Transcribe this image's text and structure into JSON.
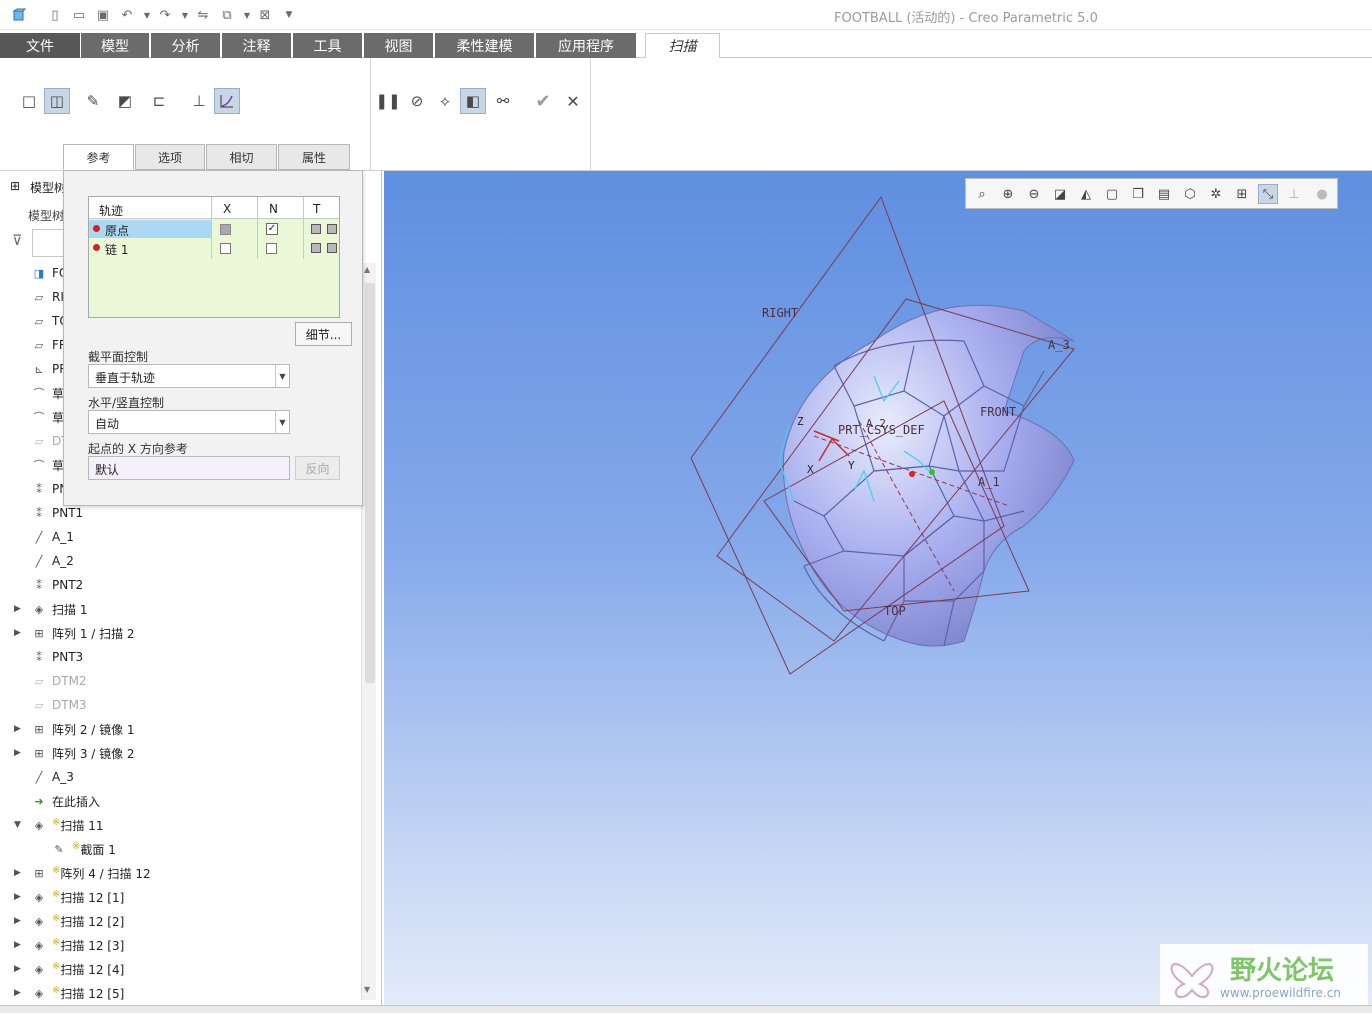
{
  "window": {
    "title": "FOOTBALL (活动的) - Creo Parametric 5.0"
  },
  "quick_access": {
    "icons": [
      "app-icon",
      "new-icon",
      "open-icon",
      "save-icon",
      "undo-icon",
      "undo-dropdown-icon",
      "redo-icon",
      "redo-dropdown-icon",
      "regenerate-icon",
      "windows-icon",
      "windows-dropdown-icon",
      "close-window-icon",
      "customize-icon"
    ]
  },
  "menu": {
    "tabs": [
      "文件",
      "模型",
      "分析",
      "注释",
      "工具",
      "视图",
      "柔性建模",
      "应用程序",
      "扫描"
    ],
    "active": "扫描"
  },
  "ribbon": {
    "subtabs": [
      "参考",
      "选项",
      "相切",
      "属性"
    ],
    "active_subtab": "参考"
  },
  "popup": {
    "table": {
      "headers": [
        "轨迹",
        "X",
        "N",
        "T"
      ],
      "rows": [
        {
          "name": "原点",
          "x": "partial",
          "n": true,
          "selected": true
        },
        {
          "name": "链 1",
          "x": false,
          "n": false,
          "selected": false
        }
      ]
    },
    "details_button": "细节...",
    "section_control_label": "截平面控制",
    "section_control_value": "垂直于轨迹",
    "hv_control_label": "水平/竖直控制",
    "hv_control_value": "自动",
    "x_ref_label": "起点的 X 方向参考",
    "x_ref_value": "默认",
    "flip_button": "反向"
  },
  "tree": {
    "header_title": "模型树",
    "header_sub": "模型树",
    "items": [
      {
        "label": "FOOTBALL",
        "icon": "part-icon",
        "arrow": "",
        "dim": false,
        "sub": false
      },
      {
        "label": "RIGHT",
        "icon": "datum-plane-icon",
        "arrow": "",
        "dim": false,
        "sub": false
      },
      {
        "label": "TOP",
        "icon": "datum-plane-icon",
        "arrow": "",
        "dim": false,
        "sub": false
      },
      {
        "label": "FRONT",
        "icon": "datum-plane-icon",
        "arrow": "",
        "dim": false,
        "sub": false
      },
      {
        "label": "PRT_CSYS_DEF",
        "icon": "csys-icon",
        "arrow": "",
        "dim": false,
        "sub": false
      },
      {
        "label": "草绘 1",
        "icon": "sketch-icon",
        "arrow": "",
        "dim": false,
        "sub": false
      },
      {
        "label": "草绘 2",
        "icon": "sketch-icon",
        "arrow": "",
        "dim": false,
        "sub": false
      },
      {
        "label": "DTM1",
        "icon": "datum-plane-icon",
        "arrow": "",
        "dim": true,
        "sub": false
      },
      {
        "label": "草绘 3",
        "icon": "sketch-icon",
        "arrow": "",
        "dim": false,
        "sub": false
      },
      {
        "label": "PNT0",
        "icon": "datum-point-icon",
        "arrow": "",
        "dim": false,
        "sub": false
      },
      {
        "label": "PNT1",
        "icon": "datum-point-icon",
        "arrow": "",
        "dim": false,
        "sub": false
      },
      {
        "label": "A_1",
        "icon": "datum-axis-icon",
        "arrow": "",
        "dim": false,
        "sub": false
      },
      {
        "label": "A_2",
        "icon": "datum-axis-icon",
        "arrow": "",
        "dim": false,
        "sub": false
      },
      {
        "label": "PNT2",
        "icon": "datum-point-icon",
        "arrow": "",
        "dim": false,
        "sub": false
      },
      {
        "label": "扫描 1",
        "icon": "sweep-icon",
        "arrow": "▶",
        "dim": false,
        "sub": false
      },
      {
        "label": "阵列 1 / 扫描 2",
        "icon": "pattern-icon",
        "arrow": "▶",
        "dim": false,
        "sub": false
      },
      {
        "label": "PNT3",
        "icon": "datum-point-icon",
        "arrow": "",
        "dim": false,
        "sub": false
      },
      {
        "label": "DTM2",
        "icon": "datum-plane-icon",
        "arrow": "",
        "dim": true,
        "sub": false
      },
      {
        "label": "DTM3",
        "icon": "datum-plane-icon",
        "arrow": "",
        "dim": true,
        "sub": false
      },
      {
        "label": "阵列 2 / 镜像 1",
        "icon": "pattern-icon",
        "arrow": "▶",
        "dim": false,
        "sub": false
      },
      {
        "label": "阵列 3 / 镜像 2",
        "icon": "pattern-icon",
        "arrow": "▶",
        "dim": false,
        "sub": false
      },
      {
        "label": "A_3",
        "icon": "datum-axis-icon",
        "arrow": "",
        "dim": false,
        "sub": false
      },
      {
        "label": "在此插入",
        "icon": "insert-here-icon",
        "arrow": "",
        "dim": false,
        "sub": false
      },
      {
        "label": "扫描 11",
        "icon": "sweep-icon",
        "arrow": "▼",
        "dim": false,
        "sub": false,
        "new": true
      },
      {
        "label": "截面 1",
        "icon": "section-sketch-icon",
        "arrow": "",
        "dim": false,
        "sub": true,
        "new": true
      },
      {
        "label": "阵列 4 / 扫描 12",
        "icon": "pattern-icon",
        "arrow": "▶",
        "dim": false,
        "sub": false,
        "new": true
      },
      {
        "label": "扫描 12 [1]",
        "icon": "sweep-icon",
        "arrow": "▶",
        "dim": false,
        "sub": false,
        "new": true
      },
      {
        "label": "扫描 12 [2]",
        "icon": "sweep-icon",
        "arrow": "▶",
        "dim": false,
        "sub": false,
        "new": true
      },
      {
        "label": "扫描 12 [3]",
        "icon": "sweep-icon",
        "arrow": "▶",
        "dim": false,
        "sub": false,
        "new": true
      },
      {
        "label": "扫描 12 [4]",
        "icon": "sweep-icon",
        "arrow": "▶",
        "dim": false,
        "sub": false,
        "new": true
      },
      {
        "label": "扫描 12 [5]",
        "icon": "sweep-icon",
        "arrow": "▶",
        "dim": false,
        "sub": false,
        "new": true
      }
    ]
  },
  "viewport": {
    "labels": {
      "right": "RIGHT",
      "front": "FRONT",
      "top": "TOP",
      "csys": "PRT_CSYS_DEF",
      "a1": "A_1",
      "a2": "A_2",
      "a3": "A_3",
      "z": "Z",
      "x": "X",
      "y": "Y"
    }
  },
  "watermark": {
    "cn": "野火论坛",
    "url": "www.proewildfire.cn"
  }
}
